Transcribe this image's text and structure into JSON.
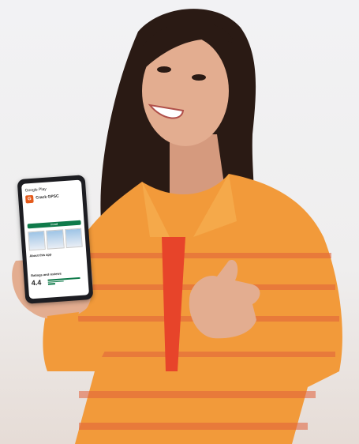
{
  "store": {
    "header": "Google Play",
    "app_name": "Crack GPSC",
    "install_label": "Install",
    "about_heading": "About this app",
    "ratings_heading": "Ratings and reviews",
    "rating_value": "4.4"
  },
  "colors": {
    "background": "#efeeee",
    "shirt": "#f29a3a",
    "accent_green": "#0f7a4a",
    "app_icon": "#e45a1b"
  }
}
